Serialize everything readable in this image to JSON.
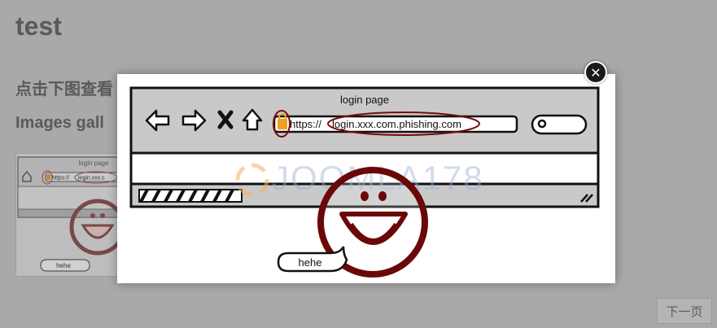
{
  "page": {
    "title": "test",
    "heading_click": "点击下图查看",
    "heading_gallery": "Images gall",
    "next_page": "下一页"
  },
  "lightbox": {
    "close_glyph": "✕"
  },
  "sketch": {
    "window_title": "login page",
    "url_prefix": "https://",
    "url_domain": "login.xxx.com.phishing.com",
    "speech_text": "hehe",
    "watermark": "JOOMLA178"
  },
  "thumbnail": {
    "window_title": "login page",
    "url_prefix": "https://",
    "url_domain": "login.xxx.c",
    "speech_text": "hehe"
  },
  "colors": {
    "backdrop": "#a9a9a9",
    "sketch_red": "#7a0a0a",
    "lock_orange": "#f0a020",
    "browser_gray": "#c9c9c9"
  }
}
